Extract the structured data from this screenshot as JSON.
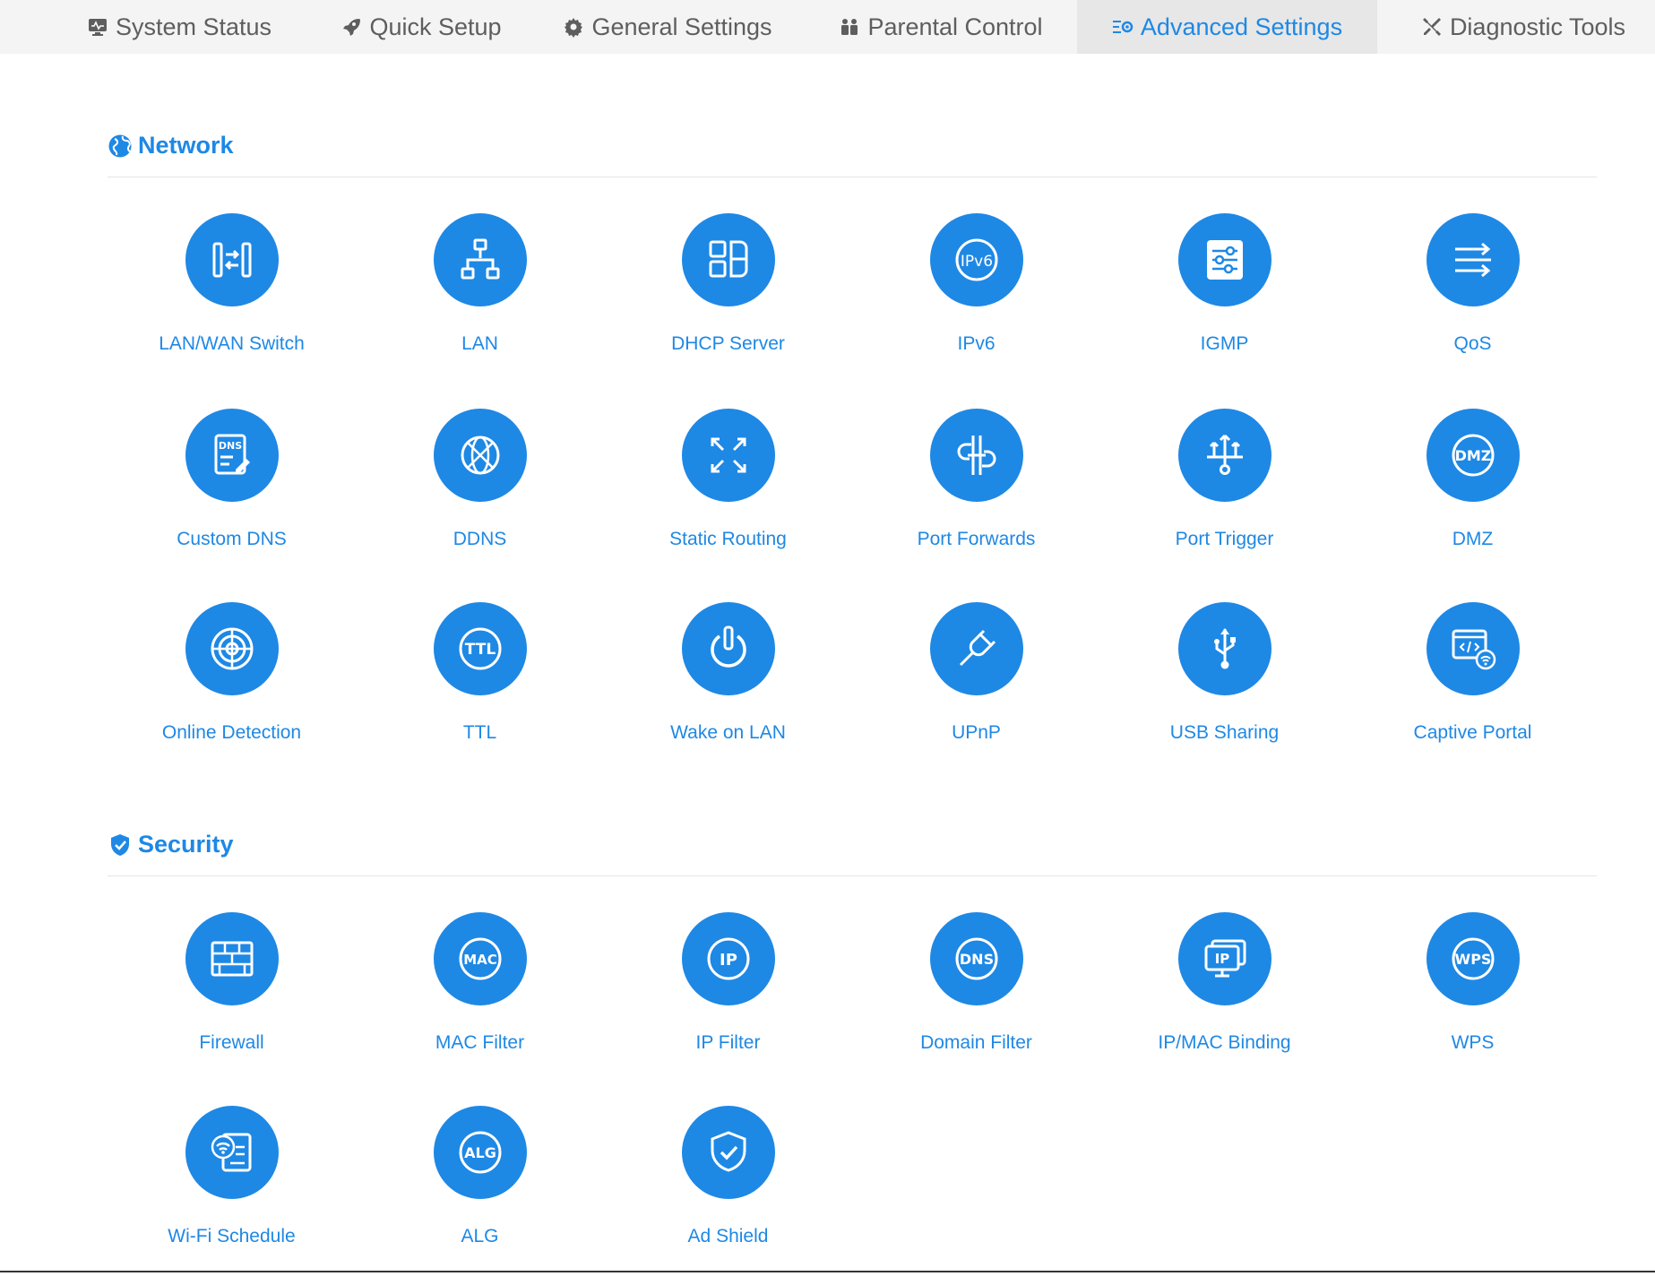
{
  "tabs": [
    {
      "label": "System Status",
      "icon": "monitor-icon",
      "active": false
    },
    {
      "label": "Quick Setup",
      "icon": "rocket-icon",
      "active": false
    },
    {
      "label": "General Settings",
      "icon": "gear-icon",
      "active": false
    },
    {
      "label": "Parental Control",
      "icon": "family-icon",
      "active": false
    },
    {
      "label": "Advanced Settings",
      "icon": "sliders-gear-icon",
      "active": true
    },
    {
      "label": "Diagnostic Tools",
      "icon": "tools-icon",
      "active": false
    }
  ],
  "colors": {
    "accent": "#1e88e5",
    "tab_bar": "#f4f4f4",
    "tab_active": "#e7e7e7",
    "tab_text": "#5e5e5e"
  },
  "sections": [
    {
      "title": "Network",
      "icon": "globe-icon",
      "items": [
        {
          "label": "LAN/WAN Switch",
          "icon": "lan-wan-switch-icon"
        },
        {
          "label": "LAN",
          "icon": "lan-icon"
        },
        {
          "label": "DHCP Server",
          "icon": "dhcp-server-icon"
        },
        {
          "label": "IPv6",
          "icon": "ipv6-icon"
        },
        {
          "label": "IGMP",
          "icon": "igmp-icon"
        },
        {
          "label": "QoS",
          "icon": "qos-icon"
        },
        {
          "label": "Custom DNS",
          "icon": "custom-dns-icon"
        },
        {
          "label": "DDNS",
          "icon": "ddns-icon"
        },
        {
          "label": "Static Routing",
          "icon": "static-routing-icon"
        },
        {
          "label": "Port Forwards",
          "icon": "port-forwards-icon"
        },
        {
          "label": "Port Trigger",
          "icon": "port-trigger-icon"
        },
        {
          "label": "DMZ",
          "icon": "dmz-icon"
        },
        {
          "label": "Online Detection",
          "icon": "online-detection-icon"
        },
        {
          "label": "TTL",
          "icon": "ttl-icon"
        },
        {
          "label": "Wake on LAN",
          "icon": "wake-on-lan-icon"
        },
        {
          "label": "UPnP",
          "icon": "upnp-icon"
        },
        {
          "label": "USB Sharing",
          "icon": "usb-sharing-icon"
        },
        {
          "label": "Captive Portal",
          "icon": "captive-portal-icon"
        }
      ]
    },
    {
      "title": "Security",
      "icon": "shield-check-icon",
      "items": [
        {
          "label": "Firewall",
          "icon": "firewall-icon"
        },
        {
          "label": "MAC Filter",
          "icon": "mac-filter-icon"
        },
        {
          "label": "IP Filter",
          "icon": "ip-filter-icon"
        },
        {
          "label": "Domain Filter",
          "icon": "domain-filter-icon"
        },
        {
          "label": "IP/MAC Binding",
          "icon": "ip-mac-binding-icon"
        },
        {
          "label": "WPS",
          "icon": "wps-icon"
        },
        {
          "label": "Wi-Fi Schedule",
          "icon": "wifi-schedule-icon"
        },
        {
          "label": "ALG",
          "icon": "alg-icon"
        },
        {
          "label": "Ad Shield",
          "icon": "ad-shield-icon"
        }
      ]
    }
  ]
}
